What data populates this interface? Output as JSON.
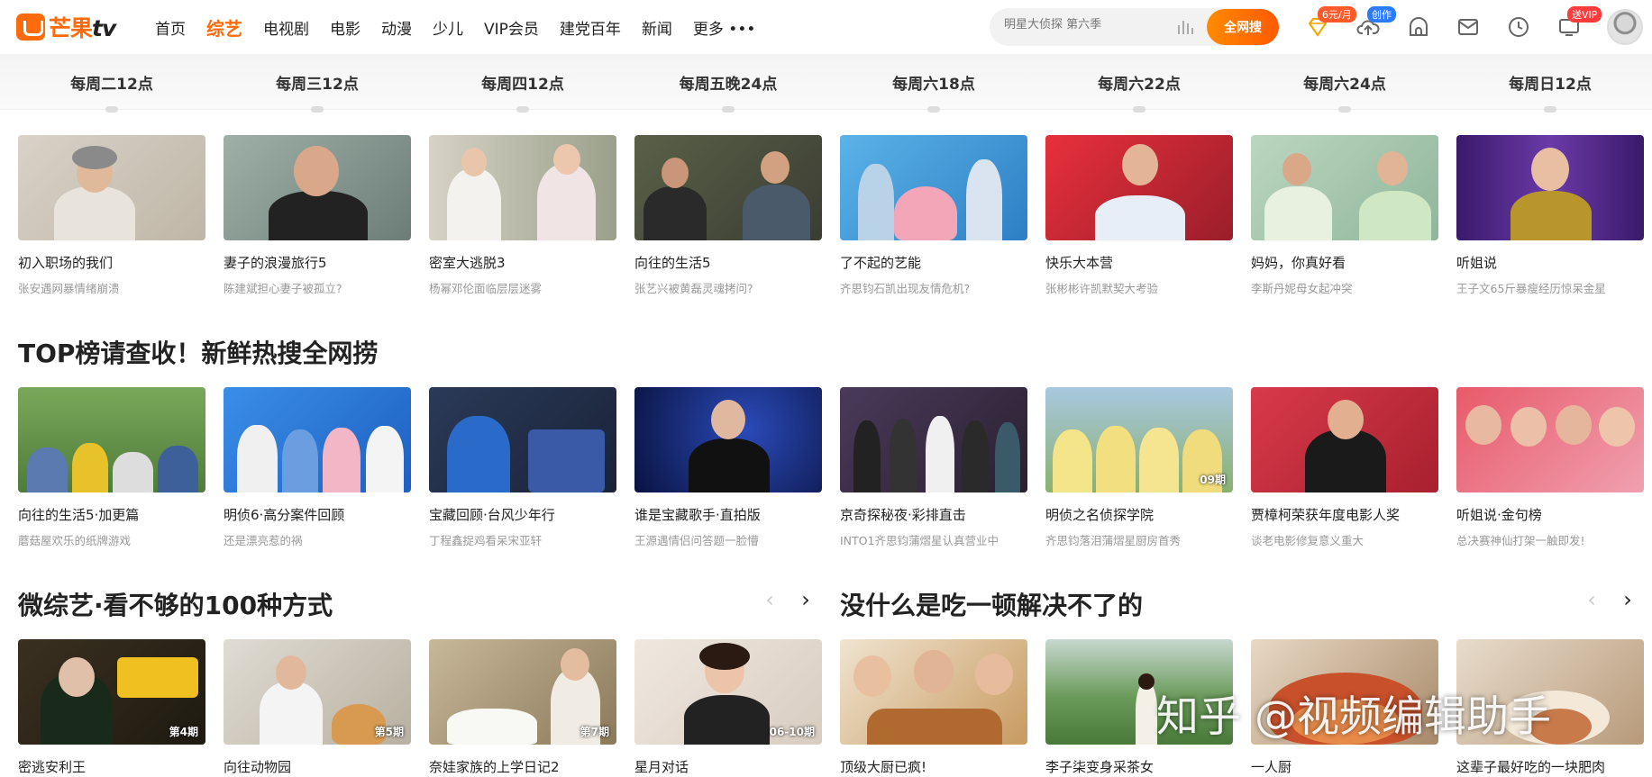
{
  "logo": {
    "brand": "芒果",
    "suffix": "tv"
  },
  "nav": [
    "首页",
    "综艺",
    "电视剧",
    "电影",
    "动漫",
    "少儿",
    "VIP会员",
    "建党百年",
    "新闻",
    "更多 •••"
  ],
  "nav_active": "综艺",
  "search": {
    "placeholder": "明星大侦探 第六季",
    "button": "全网搜"
  },
  "header_icons": [
    {
      "icon": "vip-diamond-icon",
      "badge": "6元/月"
    },
    {
      "icon": "upload-cloud-icon",
      "badge": "创作"
    },
    {
      "icon": "home-icon"
    },
    {
      "icon": "mail-icon"
    },
    {
      "icon": "history-clock-icon"
    },
    {
      "icon": "screen-icon",
      "badge": "送VIP"
    }
  ],
  "schedule": [
    "每周二12点",
    "每周三12点",
    "每周四12点",
    "每周五晚24点",
    "每周六18点",
    "每周六22点",
    "每周六24点",
    "每周日12点"
  ],
  "row1": [
    {
      "title": "初入职场的我们",
      "sub": "张安遇网暴情绪崩溃"
    },
    {
      "title": "妻子的浪漫旅行5",
      "sub": "陈建斌担心妻子被孤立?"
    },
    {
      "title": "密室大逃脱3",
      "sub": "杨幂邓伦面临层层迷雾"
    },
    {
      "title": "向往的生活5",
      "sub": "张艺兴被黄磊灵魂拷问?"
    },
    {
      "title": "了不起的艺能",
      "sub": "齐思钧石凯出现友情危机?"
    },
    {
      "title": "快乐大本营",
      "sub": "张彬彬许凯默契大考验"
    },
    {
      "title": "妈妈，你真好看",
      "sub": "李斯丹妮母女起冲突"
    },
    {
      "title": "听姐说",
      "sub": "王子文65斤暴瘦经历惊呆金星"
    }
  ],
  "section2_title": "TOP榜请查收！新鲜热搜全网捞",
  "row2": [
    {
      "title": "向往的生活5·加更篇",
      "sub": "蘑菇屋欢乐的纸牌游戏",
      "ep": ""
    },
    {
      "title": "明侦6·高分案件回顾",
      "sub": "还是漂亮惹的祸",
      "ep": ""
    },
    {
      "title": "宝藏回顾·台风少年行",
      "sub": "丁程鑫捉鸡看呆宋亚轩",
      "ep": ""
    },
    {
      "title": "谁是宝藏歌手·直拍版",
      "sub": "王源遇情侣问答题一脸懵",
      "ep": ""
    },
    {
      "title": "京奇探秘夜·彩排直击",
      "sub": "INTO1齐思钧蒲熠星认真营业中",
      "ep": ""
    },
    {
      "title": "明侦之名侦探学院",
      "sub": "齐思钧落泪蒲熠星厨房首秀",
      "ep": "09期"
    },
    {
      "title": "贾樟柯荣获年度电影人奖",
      "sub": "谈老电影修复意义重大",
      "ep": ""
    },
    {
      "title": "听姐说·金句榜",
      "sub": "总决赛神仙打架一触即发!",
      "ep": ""
    }
  ],
  "section3_title": "微综艺·看不够的100种方式",
  "section4_title": "没什么是吃一顿解决不了的",
  "row3": [
    {
      "title": "密逃安利王",
      "ep": "第4期"
    },
    {
      "title": "向往动物园",
      "ep": "第5期"
    },
    {
      "title": "奈娃家族的上学日记2",
      "ep": "第7期"
    },
    {
      "title": "星月对话",
      "ep": "06-10期"
    },
    {
      "title": "顶级大厨已疯!",
      "ep": ""
    },
    {
      "title": "李子柒变身采茶女",
      "ep": ""
    },
    {
      "title": "一人厨",
      "ep": ""
    },
    {
      "title": "这辈子最好吃的一块肥肉",
      "ep": ""
    }
  ],
  "watermark": "知乎 @视频编辑助手",
  "colors": {
    "accent": "#ff6a0a",
    "text": "#222222",
    "subtext": "#999999"
  }
}
